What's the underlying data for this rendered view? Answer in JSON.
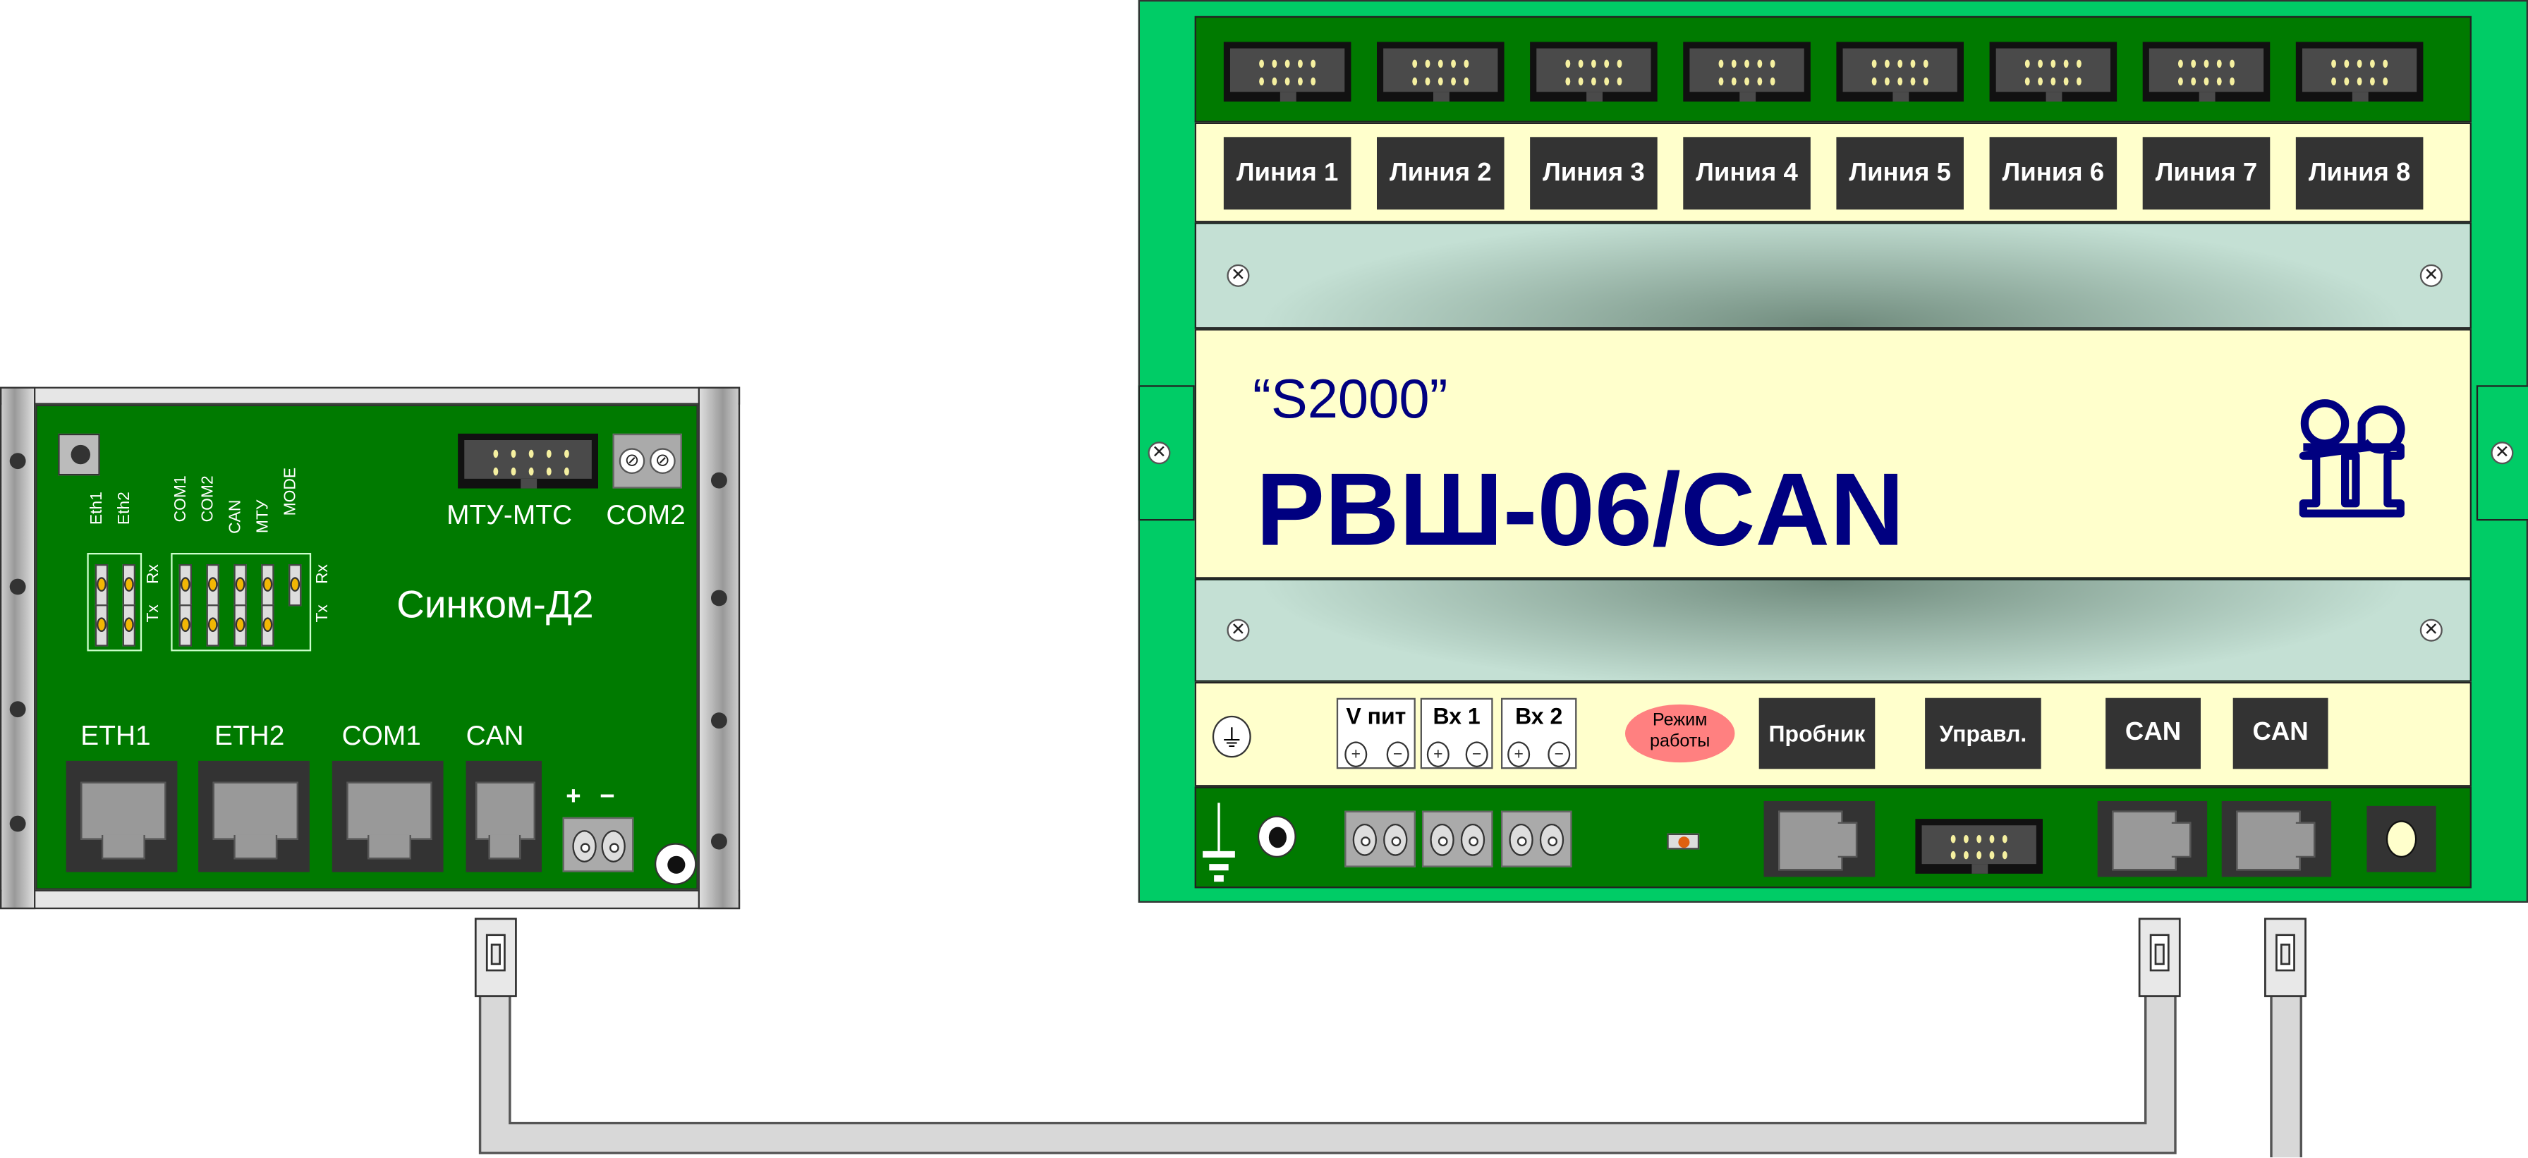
{
  "colors": {
    "pcb_dark": "#007a00",
    "case_green": "#00cc66",
    "panel_yellow": "#ffffcc",
    "panel_gray": "#c4e0d4",
    "title_blue": "#000080",
    "pill_red": "#ff8080",
    "cable_gray": "#d8d8d8"
  },
  "left_device": {
    "name": "Синком-Д2",
    "header_label": "МТУ-МТС",
    "com2_label": "COM2",
    "led_group1": {
      "labels": [
        "Eth1",
        "Eth2"
      ]
    },
    "led_group2": {
      "labels": [
        "COM1",
        "COM2",
        "CAN",
        "МТУ",
        "MODE"
      ]
    },
    "rx_label": "Rx",
    "tx_label": "Tx",
    "ports": [
      {
        "label": "ETH1"
      },
      {
        "label": "ETH2"
      },
      {
        "label": "COM1"
      },
      {
        "label": "CAN"
      }
    ],
    "plus": "+",
    "minus": "−"
  },
  "right_device": {
    "series": "“S2000”",
    "model": "РВШ-06/CAN",
    "lines": [
      "Линия 1",
      "Линия 2",
      "Линия 3",
      "Линия 4",
      "Линия 5",
      "Линия 6",
      "Линия 7",
      "Линия 8"
    ],
    "terminals": [
      {
        "label": "V пит"
      },
      {
        "label": "Вх 1"
      },
      {
        "label": "Вх 2"
      }
    ],
    "plus": "+",
    "minus": "−",
    "mode_label": "Режим работы",
    "probe_label": "Пробник",
    "control_label": "Управл.",
    "can1_label": "CAN",
    "can2_label": "CAN",
    "logo": "bolid-logo-icon"
  }
}
